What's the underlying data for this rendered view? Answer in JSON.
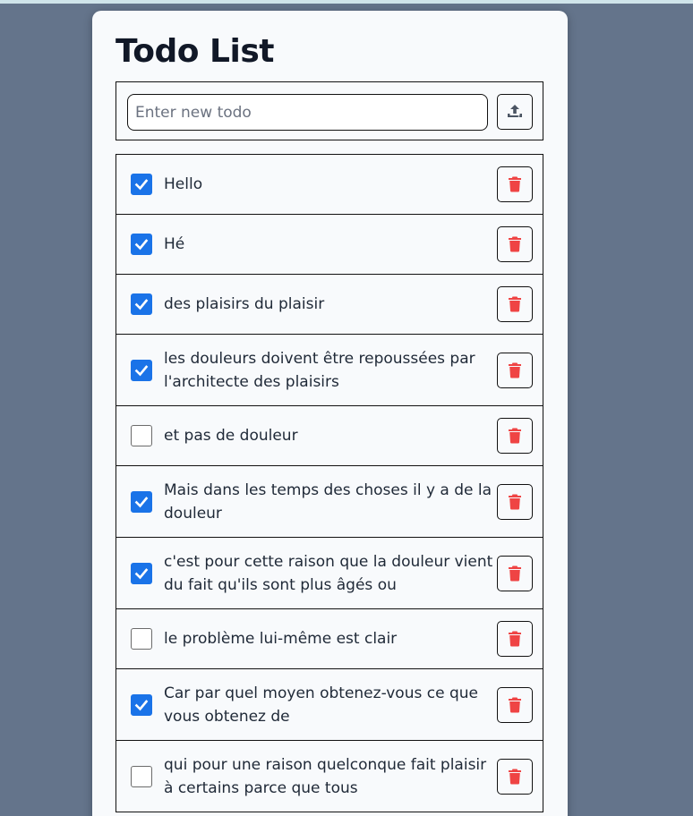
{
  "app": {
    "title": "Todo List"
  },
  "add_form": {
    "placeholder": "Enter new todo",
    "value": "",
    "submit_icon": "upload-icon"
  },
  "colors": {
    "background": "#64748b",
    "card": "#f8fafc",
    "checkbox_checked": "#1a73e8",
    "delete_icon": "#ef4444"
  },
  "todos": [
    {
      "text": "Hello",
      "done": true
    },
    {
      "text": "Hé",
      "done": true
    },
    {
      "text": "des plaisirs du plaisir",
      "done": true
    },
    {
      "text": "les douleurs doivent être repoussées par l'architecte des plaisirs",
      "done": true
    },
    {
      "text": "et pas de douleur",
      "done": false
    },
    {
      "text": "Mais dans les temps des choses il y a de la douleur",
      "done": true
    },
    {
      "text": "c'est pour cette raison que la douleur vient du fait qu'ils sont plus âgés ou",
      "done": true
    },
    {
      "text": "le problème lui-même est clair",
      "done": false
    },
    {
      "text": "Car par quel moyen obtenez-vous ce que vous obtenez de",
      "done": true
    },
    {
      "text": "qui pour une raison quelconque fait plaisir à certains parce que tous",
      "done": false
    }
  ],
  "todo_icons": {
    "delete": "trash-icon",
    "check": "checkmark-icon"
  }
}
